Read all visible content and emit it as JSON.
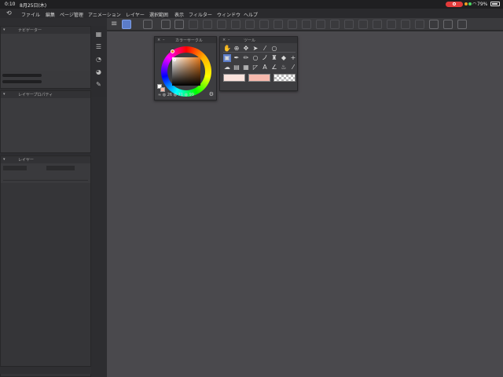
{
  "status_bar": {
    "time": "0:10",
    "date": "8月25日(木)",
    "battery_percent": "79%"
  },
  "menu": {
    "items": [
      "ファイル",
      "編集",
      "ページ管理",
      "アニメーション",
      "レイヤー",
      "選択範囲",
      "表示",
      "フィルター",
      "ウィンドウ",
      "ヘルプ"
    ]
  },
  "palettes": {
    "navigator_title": "ナビゲーター",
    "layer_property_title": "レイヤープロパティ",
    "layer_title": "レイヤー",
    "color_circle_title": "カラーサークル",
    "tool_title": "ツール"
  },
  "color": {
    "main": "#ffffff",
    "sub": "#f3b8a8",
    "hue_marker": "#e87a1a",
    "h": "26",
    "s": "71",
    "v": "99"
  },
  "theme": {
    "canvas_bg": "#4a494d",
    "accent": "#5b7cc9"
  },
  "tools": {
    "row1": [
      "hand-icon",
      "zoom-icon",
      "move-icon",
      "operation-icon",
      "eyedropper-icon",
      "magnify-icon"
    ],
    "row2": [
      "select-icon",
      "pen-icon",
      "pencil-icon",
      "circle-icon",
      "brush-icon",
      "airbrush-icon",
      "fill-icon",
      "plus-icon"
    ],
    "row3": [
      "decoration-icon",
      "eraser-icon",
      "figure-icon",
      "frame-icon",
      "text-icon",
      "balloon-icon",
      "gradient-icon",
      "blend-icon"
    ],
    "color_chips": [
      "#fbe3dc",
      "#f7b9ad",
      "transparent"
    ]
  }
}
